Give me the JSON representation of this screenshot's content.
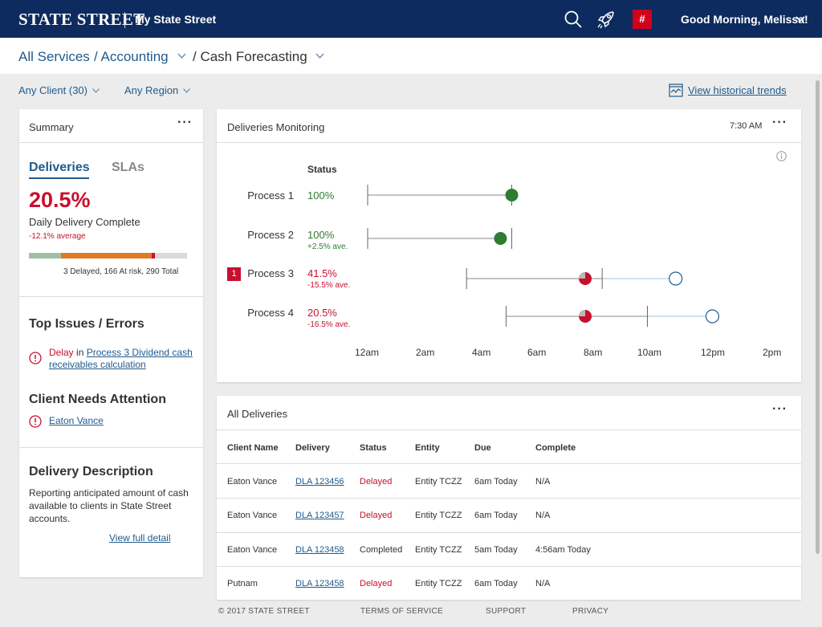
{
  "header": {
    "logo_text": "STATE STREET",
    "app_name": "My State Street",
    "notifications_badge": "#",
    "greeting": "Good Morning, Melissa!"
  },
  "breadcrumb": {
    "items": [
      "All Services",
      "/ Accounting",
      "/ Cash Forecasting"
    ]
  },
  "filters": {
    "client": "Any Client (30)",
    "region": "Any Region",
    "historical_link": "View historical trends"
  },
  "summary": {
    "title": "Summary",
    "tabs": [
      "Deliveries",
      "SLAs"
    ],
    "percent": "20.5%",
    "percent_label": "Daily Delivery Complete",
    "average_change": "-12.1% average",
    "progress": {
      "complete_pct": 20.5,
      "at_risk_pct": 57.2,
      "delayed_pct": 2.0,
      "colors": {
        "complete": "#9fbfa3",
        "at_risk": "#e07a24",
        "delayed": "#c8102e",
        "remaining": "#d9d9d9"
      }
    },
    "totals_text": "3 Delayed, 166 At risk, 290 Total",
    "top_issues": {
      "title": "Top Issues / Errors",
      "issue_prefix": "Delay",
      "issue_in": "in",
      "issue_link": "Process 3 Dividend cash receivables calculation"
    },
    "client_attention": {
      "title": "Client Needs Attention",
      "client_link": "Eaton Vance"
    },
    "description": {
      "title": "Delivery Description",
      "body": "Reporting anticipated amount of cash available to clients in State Street accounts.",
      "link": "View full detail"
    }
  },
  "monitoring": {
    "title": "Deliveries Monitoring",
    "time": "7:30 AM",
    "status_header": "Status",
    "alert_badge": "1",
    "processes": [
      {
        "name": "Process 1",
        "status": "100%",
        "sub": "",
        "state": "complete"
      },
      {
        "name": "Process 2",
        "status": "100%",
        "sub": "+2.5% ave.",
        "state": "complete"
      },
      {
        "name": "Process 3",
        "status": "41.5%",
        "sub": "-15.5% ave.",
        "state": "delayed"
      },
      {
        "name": "Process 4",
        "status": "20.5%",
        "sub": "-16.5% ave.",
        "state": "delayed"
      }
    ],
    "x_ticks": [
      "12am",
      "2am",
      "4am",
      "6am",
      "8am",
      "10am",
      "12pm",
      "2pm"
    ]
  },
  "chart_data": {
    "type": "scatter",
    "title": "Deliveries Monitoring",
    "x_ticks": [
      "12am",
      "2am",
      "4am",
      "6am",
      "8am",
      "10am",
      "12pm",
      "2pm"
    ],
    "x_unit": "hours since 12am",
    "xlim": [
      0,
      14
    ],
    "series": [
      {
        "name": "Process 1",
        "window_start": 0,
        "window_end": 5.1,
        "current": 5.1,
        "projected": null,
        "status": "100%"
      },
      {
        "name": "Process 2",
        "window_start": 0,
        "window_end": 5.1,
        "current": 4.7,
        "projected": null,
        "status": "100%"
      },
      {
        "name": "Process 3",
        "window_start": 3.5,
        "window_end": 8.3,
        "current": 7.7,
        "projected": 10.9,
        "status": "41.5%"
      },
      {
        "name": "Process 4",
        "window_start": 4.9,
        "window_end": 9.9,
        "current": 7.7,
        "projected": 12.2,
        "status": "20.5%"
      }
    ]
  },
  "deliveries": {
    "title": "All Deliveries",
    "columns": [
      "Client Name",
      "Delivery",
      "Status",
      "Entity",
      "Due",
      "Complete"
    ],
    "rows": [
      [
        "Eaton Vance",
        "DLA 123456",
        "Delayed",
        "Entity TCZZ",
        "6am Today",
        "N/A"
      ],
      [
        "Eaton Vance",
        "DLA 123457",
        "Delayed",
        "Entity TCZZ",
        "6am Today",
        "N/A"
      ],
      [
        "Eaton Vance",
        "DLA 123458",
        "Completed",
        "Entity TCZZ",
        "5am Today",
        "4:56am Today"
      ],
      [
        "Putnam",
        "DLA 123458",
        "Delayed",
        "Entity TCZZ",
        "6am Today",
        "N/A"
      ]
    ]
  },
  "footer": {
    "copyright": "© 2017 STATE STREET",
    "terms": "TERMS OF SERVICE",
    "support": "SUPPORT",
    "privacy": "PRIVACY"
  }
}
